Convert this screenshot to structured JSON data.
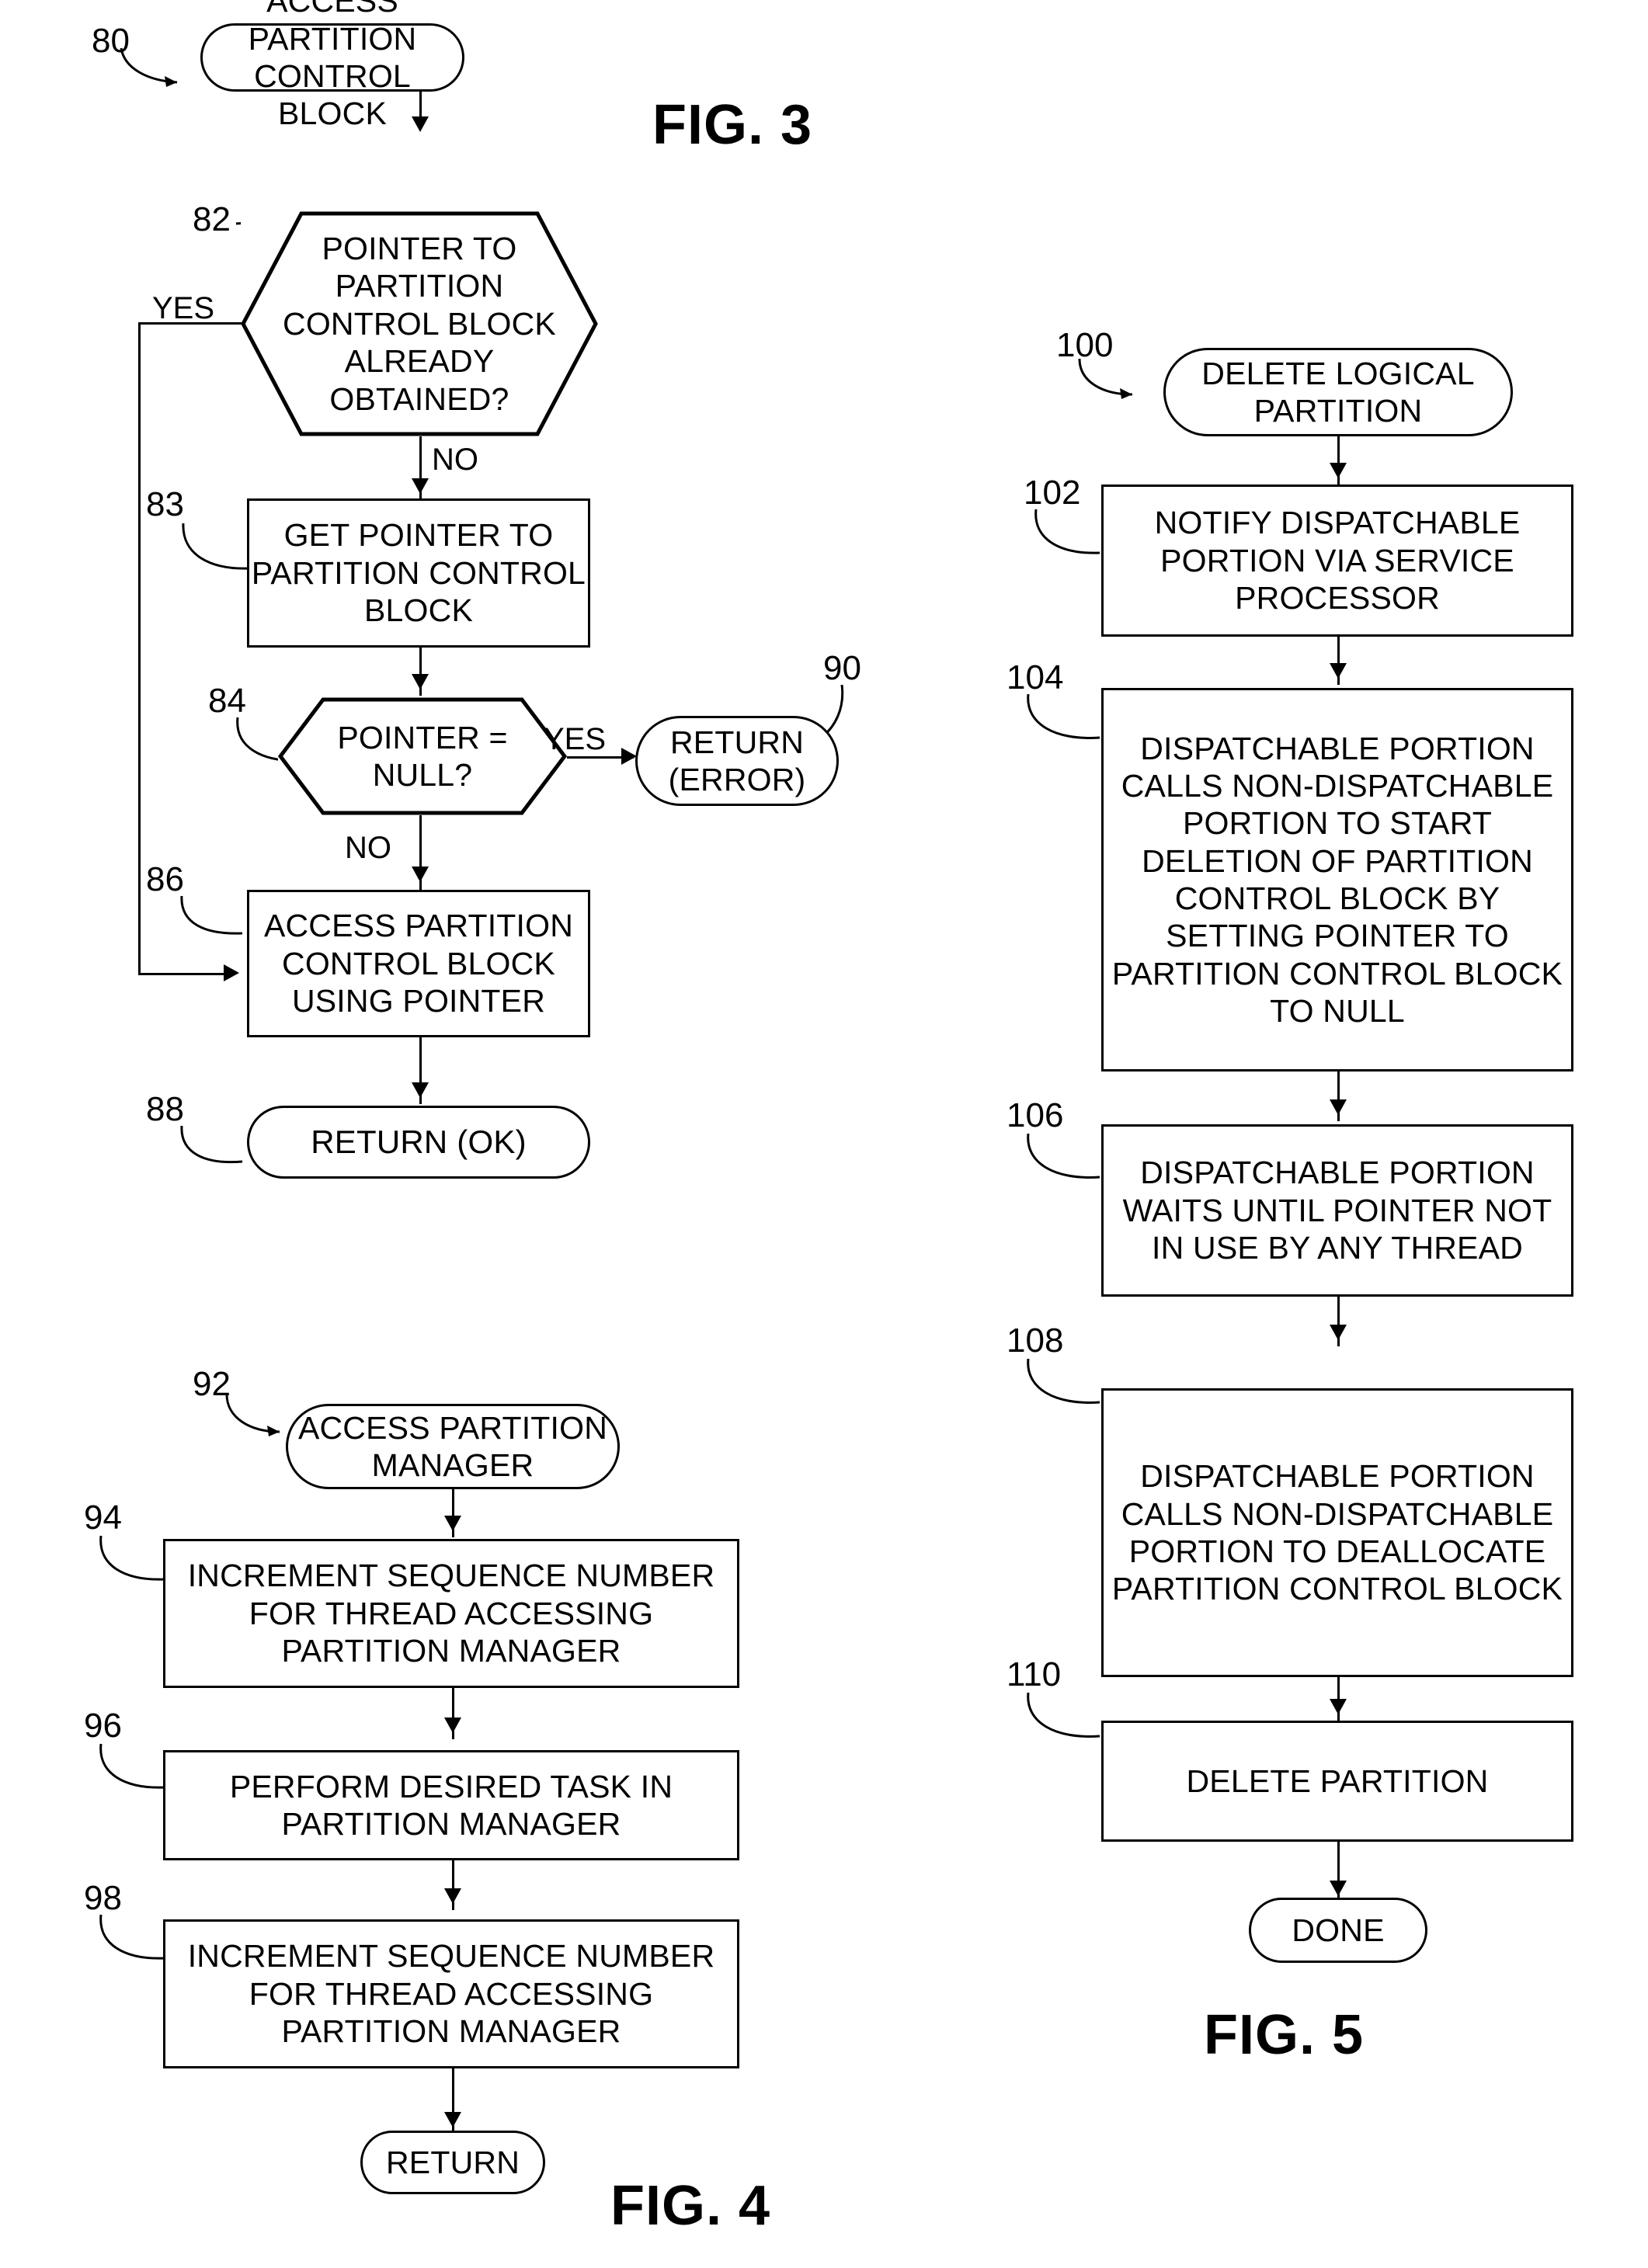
{
  "figures": [
    {
      "id": "fig3",
      "caption": "FIG. 3",
      "nodes": {
        "start": {
          "ref": "80",
          "text": "ACCESS PARTITION CONTROL BLOCK",
          "shape": "terminator"
        },
        "decision_obtained": {
          "ref": "82",
          "text": "POINTER TO PARTITION CONTROL BLOCK ALREADY OBTAINED?",
          "shape": "hexagon"
        },
        "get_pointer": {
          "ref": "83",
          "text": "GET POINTER TO PARTITION CONTROL BLOCK",
          "shape": "process"
        },
        "decision_null": {
          "ref": "84",
          "text": "POINTER = NULL?",
          "shape": "hexagon"
        },
        "return_error": {
          "ref": "90",
          "text": "RETURN (ERROR)",
          "shape": "terminator"
        },
        "access_using_pointer": {
          "ref": "86",
          "text": "ACCESS PARTITION CONTROL BLOCK USING POINTER",
          "shape": "process"
        },
        "return_ok": {
          "ref": "88",
          "text": "RETURN (OK)",
          "shape": "terminator"
        }
      },
      "edge_labels": {
        "obtained_yes": "YES",
        "obtained_no": "NO",
        "null_yes": "YES",
        "null_no": "NO"
      }
    },
    {
      "id": "fig4",
      "caption": "FIG. 4",
      "nodes": {
        "start": {
          "ref": "92",
          "text": "ACCESS PARTITION MANAGER",
          "shape": "terminator"
        },
        "increment_before": {
          "ref": "94",
          "text": "INCREMENT SEQUENCE NUMBER FOR THREAD ACCESSING PARTITION MANAGER",
          "shape": "process"
        },
        "perform_task": {
          "ref": "96",
          "text": "PERFORM DESIRED TASK IN PARTITION MANAGER",
          "shape": "process"
        },
        "increment_after": {
          "ref": "98",
          "text": "INCREMENT SEQUENCE NUMBER FOR THREAD ACCESSING PARTITION MANAGER",
          "shape": "process"
        },
        "return": {
          "text": "RETURN",
          "shape": "terminator"
        }
      }
    },
    {
      "id": "fig5",
      "caption": "FIG. 5",
      "nodes": {
        "start": {
          "ref": "100",
          "text": "DELETE LOGICAL PARTITION",
          "shape": "terminator"
        },
        "notify": {
          "ref": "102",
          "text": "NOTIFY DISPATCHABLE PORTION VIA SERVICE PROCESSOR",
          "shape": "process"
        },
        "start_deletion": {
          "ref": "104",
          "text": "DISPATCHABLE PORTION CALLS NON-DISPATCHABLE PORTION TO START DELETION OF PARTITION CONTROL BLOCK BY SETTING POINTER TO PARTITION CONTROL BLOCK TO NULL",
          "shape": "process"
        },
        "wait": {
          "ref": "106",
          "text": "DISPATCHABLE PORTION WAITS UNTIL POINTER NOT IN USE BY ANY THREAD",
          "shape": "process"
        },
        "deallocate": {
          "ref": "108",
          "text": "DISPATCHABLE PORTION CALLS NON-DISPATCHABLE PORTION TO DEALLOCATE PARTITION CONTROL BLOCK",
          "shape": "process"
        },
        "delete_partition": {
          "ref": "110",
          "text": "DELETE PARTITION",
          "shape": "process"
        },
        "done": {
          "text": "DONE",
          "shape": "terminator"
        }
      }
    }
  ],
  "colors": {
    "ink": "#000000",
    "paper": "#ffffff"
  }
}
